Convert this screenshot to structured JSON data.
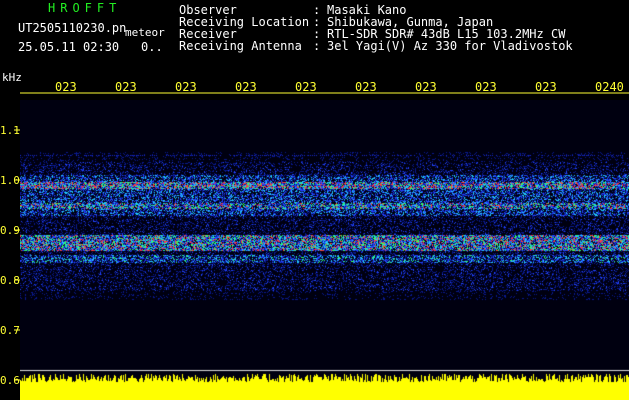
{
  "header": {
    "title": "HROFFT",
    "filename": "UT2505110230.pn",
    "detector_label": "meteor",
    "datetime": "25.05.11 02:30",
    "count": "0..",
    "info": [
      {
        "label": "Observer",
        "sep": ":",
        "value": "Masaki Kano"
      },
      {
        "label": "Receiving Location",
        "sep": ":",
        "value": "Shibukawa, Gunma, Japan"
      },
      {
        "label": "Receiver",
        "sep": ":",
        "value": "RTL-SDR SDR# 43dB L15 103.2MHz CW"
      },
      {
        "label": "Receiving Antenna",
        "sep": ":",
        "value": "3el Yagi(V) Az 330 for Vladivostok"
      }
    ]
  },
  "axis": {
    "unit": "kHz",
    "y_ticks": [
      "1.1",
      "1.0",
      "0.9",
      "0.8",
      "0.7",
      "0.6"
    ],
    "x_ticks": [
      "023",
      "023",
      "023",
      "023",
      "023",
      "023",
      "023",
      "023",
      "023",
      "0240"
    ]
  },
  "colors": {
    "background": "#000000",
    "label_green": "#22ee22",
    "tick_yellow": "#ffff33",
    "noise_band": "#ffff00"
  }
}
